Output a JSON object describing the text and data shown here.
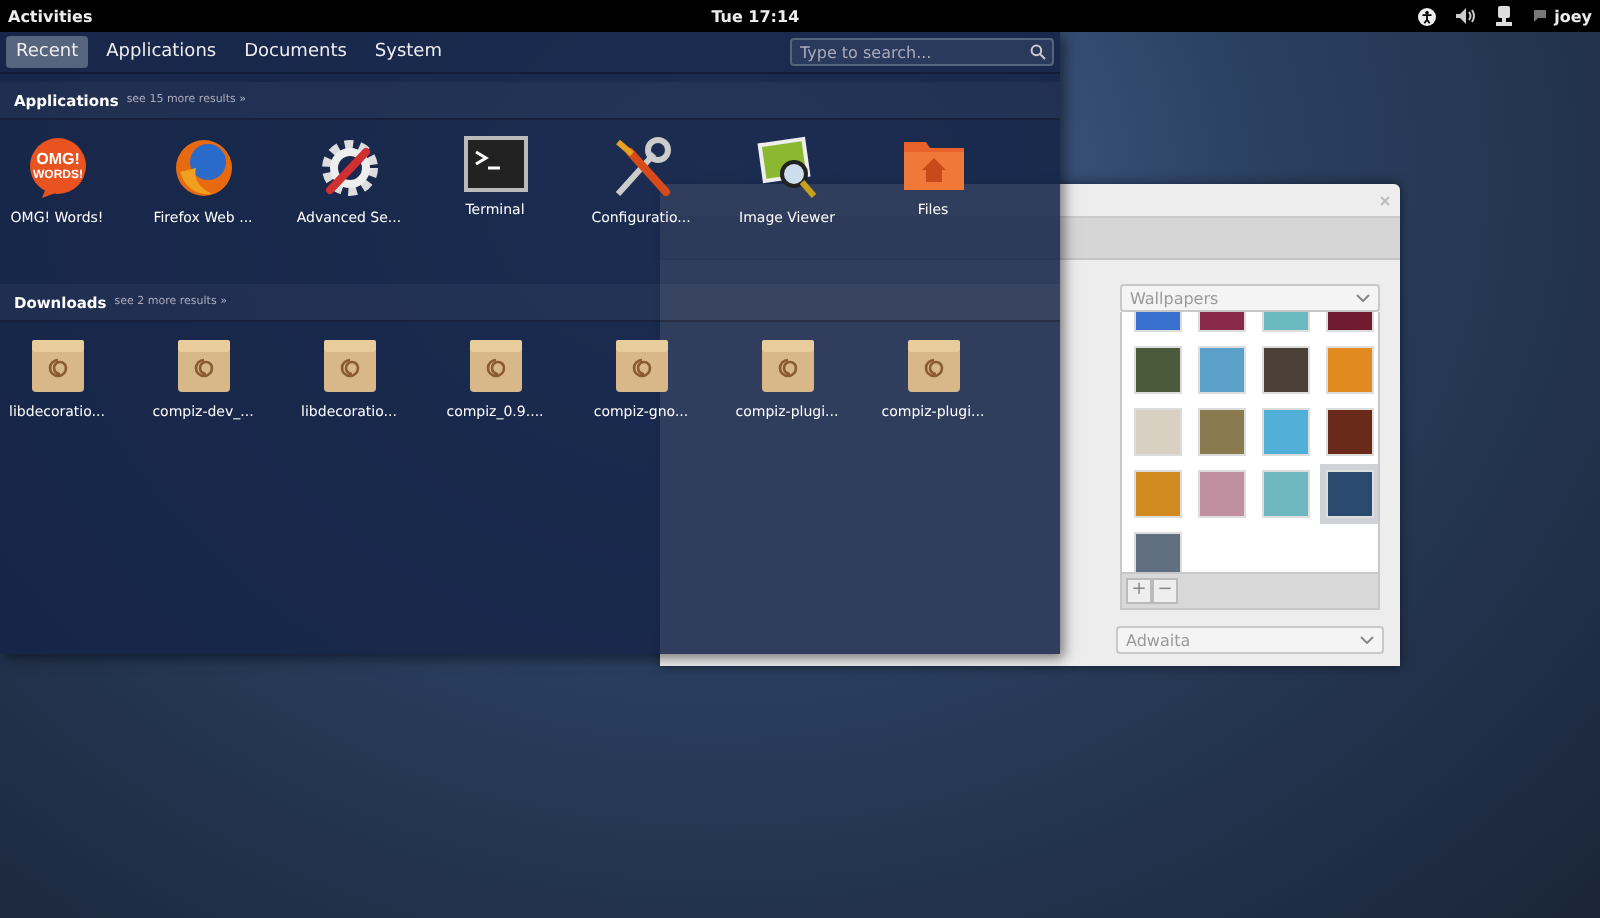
{
  "top_bar": {
    "activities": "Activities",
    "clock": "Tue 17:14",
    "user": "joey"
  },
  "overview": {
    "tabs": [
      {
        "label": "Recent",
        "selected": true
      },
      {
        "label": "Applications",
        "selected": false
      },
      {
        "label": "Documents",
        "selected": false
      },
      {
        "label": "System",
        "selected": false
      }
    ],
    "search": {
      "placeholder": "Type to search..."
    },
    "sections": [
      {
        "title": "Applications",
        "more": "see 15 more results »",
        "items": [
          {
            "label": "OMG! Words!",
            "kind": "bubble",
            "icon_text": [
              "OMG!",
              "WORDS!"
            ]
          },
          {
            "label": "Firefox Web ...",
            "kind": "globe"
          },
          {
            "label": "Advanced Se...",
            "kind": "gear"
          },
          {
            "label": "Terminal",
            "kind": "terminal"
          },
          {
            "label": "Configuratio...",
            "kind": "tools"
          },
          {
            "label": "Image Viewer",
            "kind": "viewer"
          },
          {
            "label": "Files",
            "kind": "folder"
          }
        ]
      },
      {
        "title": "Downloads",
        "more": "see 2 more results »",
        "items": [
          {
            "label": "libdecoratio...",
            "kind": "package"
          },
          {
            "label": "compiz-dev_...",
            "kind": "package"
          },
          {
            "label": "libdecoratio...",
            "kind": "package"
          },
          {
            "label": "compiz_0.9....",
            "kind": "package"
          },
          {
            "label": "compiz-gno...",
            "kind": "package"
          },
          {
            "label": "compiz-plugi...",
            "kind": "package"
          },
          {
            "label": "compiz-plugi...",
            "kind": "package"
          }
        ]
      }
    ]
  },
  "window": {
    "wallpaper_source": "Wallpapers",
    "wallpapers": [
      {
        "color": "#3a70d0",
        "selected": false
      },
      {
        "color": "#8a2a4a",
        "selected": false
      },
      {
        "color": "#6ab8c0",
        "selected": false
      },
      {
        "color": "#701a30",
        "selected": false
      },
      {
        "color": "#4a5a3a",
        "selected": false
      },
      {
        "color": "#5aa0c8",
        "selected": false
      },
      {
        "color": "#4a4035",
        "selected": false
      },
      {
        "color": "#e08a20",
        "selected": false
      },
      {
        "color": "#d8d0c0",
        "selected": false
      },
      {
        "color": "#8a7a50",
        "selected": false
      },
      {
        "color": "#50b0d8",
        "selected": false
      },
      {
        "color": "#6a2a1a",
        "selected": false
      },
      {
        "color": "#d08a20",
        "selected": false
      },
      {
        "color": "#c090a0",
        "selected": false
      },
      {
        "color": "#70b8c0",
        "selected": false
      },
      {
        "color": "#2a4a70",
        "selected": true
      },
      {
        "color": "#607080",
        "selected": false
      }
    ],
    "add_button": "+",
    "remove_button": "−",
    "theme": "Adwaita"
  }
}
